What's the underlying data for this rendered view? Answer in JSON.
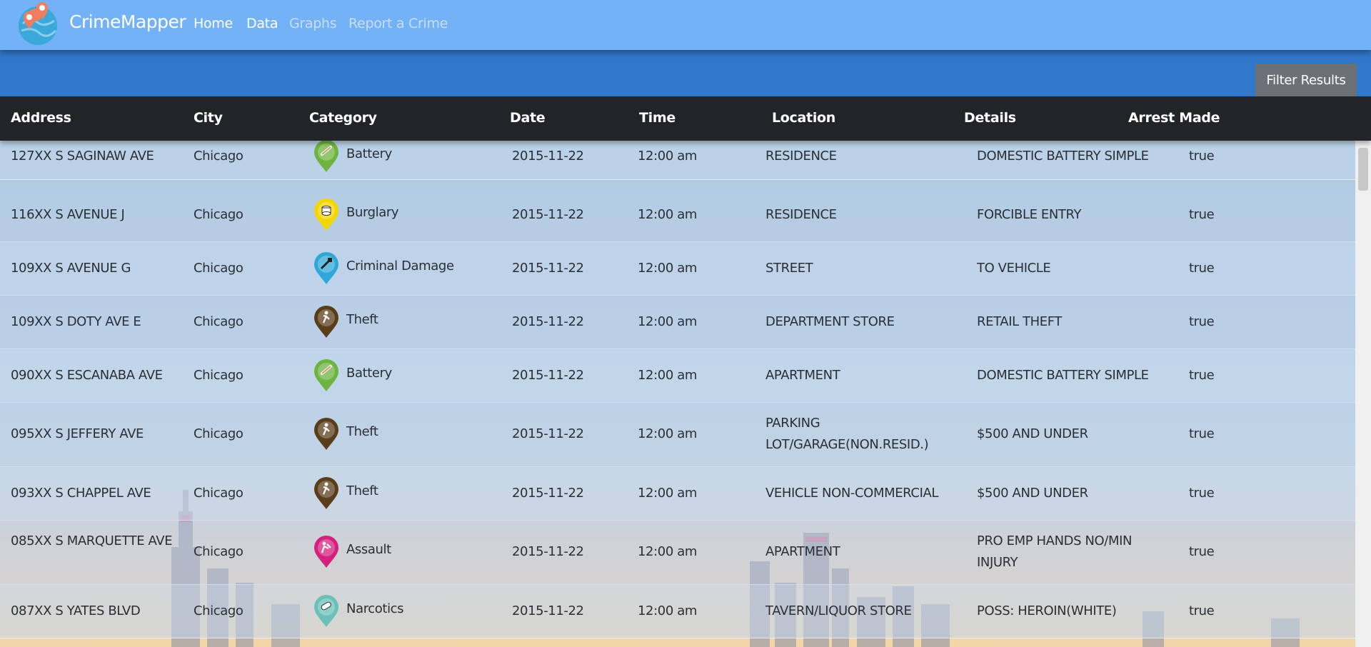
{
  "app": {
    "name": "CrimeMapper"
  },
  "nav": {
    "home": "Home",
    "data": "Data",
    "graphs": "Graphs",
    "report": "Report a Crime"
  },
  "filter_button": "Filter Results",
  "table": {
    "headers": [
      "Address",
      "City",
      "Category",
      "Date",
      "Time",
      "Location",
      "Details",
      "Arrest Made"
    ],
    "rows": [
      {
        "address": "127XX S SAGINAW AVE",
        "city": "Chicago",
        "category": "Battery",
        "icon": "battery-pin-icon",
        "color": "#6cb33f",
        "date": "2015-11-22",
        "time": "12:00 am",
        "location": "RESIDENCE",
        "details": "DOMESTIC BATTERY SIMPLE",
        "arrest": "true"
      },
      {
        "address": "116XX S AVENUE J",
        "city": "Chicago",
        "category": "Burglary",
        "icon": "burglary-pin-icon",
        "color": "#f2d600",
        "date": "2015-11-22",
        "time": "12:00 am",
        "location": "RESIDENCE",
        "details": "FORCIBLE ENTRY",
        "arrest": "true"
      },
      {
        "address": "109XX S AVENUE G",
        "city": "Chicago",
        "category": "Criminal Damage",
        "icon": "criminal-damage-pin-icon",
        "color": "#2fa8d8",
        "date": "2015-11-22",
        "time": "12:00 am",
        "location": "STREET",
        "details": "TO VEHICLE",
        "arrest": "true"
      },
      {
        "address": "109XX S DOTY AVE E",
        "city": "Chicago",
        "category": "Theft",
        "icon": "theft-pin-icon",
        "color": "#5a3e1b",
        "date": "2015-11-22",
        "time": "12:00 am",
        "location": "DEPARTMENT STORE",
        "details": "RETAIL THEFT",
        "arrest": "true"
      },
      {
        "address": "090XX S ESCANABA AVE",
        "city": "Chicago",
        "category": "Battery",
        "icon": "battery-pin-icon",
        "color": "#6cb33f",
        "date": "2015-11-22",
        "time": "12:00 am",
        "location": "APARTMENT",
        "details": "DOMESTIC BATTERY SIMPLE",
        "arrest": "true"
      },
      {
        "address": "095XX S JEFFERY AVE",
        "city": "Chicago",
        "category": "Theft",
        "icon": "theft-pin-icon",
        "color": "#5a3e1b",
        "date": "2015-11-22",
        "time": "12:00 am",
        "location": "PARKING LOT/GARAGE(NON.RESID.)",
        "details": "$500 AND UNDER",
        "arrest": "true"
      },
      {
        "address": "093XX S CHAPPEL AVE",
        "city": "Chicago",
        "category": "Theft",
        "icon": "theft-pin-icon",
        "color": "#5a3e1b",
        "date": "2015-11-22",
        "time": "12:00 am",
        "location": "VEHICLE NON-COMMERCIAL",
        "details": "$500 AND UNDER",
        "arrest": "true"
      },
      {
        "address": "085XX S MARQUETTE AVE",
        "city": "Chicago",
        "category": "Assault",
        "icon": "assault-pin-icon",
        "color": "#d4207e",
        "date": "2015-11-22",
        "time": "12:00 am",
        "location": "APARTMENT",
        "details": "PRO EMP HANDS NO/MIN INJURY",
        "arrest": "true"
      },
      {
        "address": "087XX S YATES BLVD",
        "city": "Chicago",
        "category": "Narcotics",
        "icon": "narcotics-pin-icon",
        "color": "#6bc0b8",
        "date": "2015-11-22",
        "time": "12:00 am",
        "location": "TAVERN/LIQUOR STORE",
        "details": "POSS: HEROIN(WHITE)",
        "arrest": "true"
      }
    ]
  }
}
